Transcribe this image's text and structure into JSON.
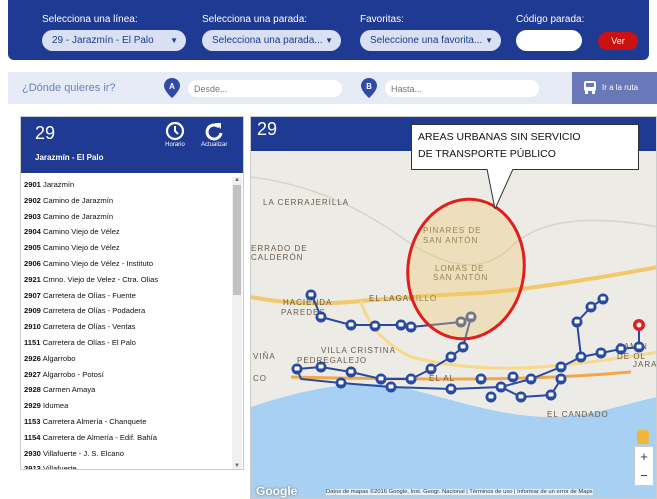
{
  "top": {
    "line_label": "Selecciona una línea:",
    "line_value": "29 - Jarazmín - El Palo",
    "stop_label": "Selecciona una parada:",
    "stop_value": "Selecciona una parada...",
    "fav_label": "Favoritas:",
    "fav_value": "Seleccione una favorita...",
    "code_label": "Código parada:",
    "ver_label": "Ver"
  },
  "route": {
    "question": "¿Dónde quieres ir?",
    "from_marker": "A",
    "from_placeholder": "Desde...",
    "to_marker": "B",
    "to_placeholder": "Hasta...",
    "go_label": "Ir a la ruta"
  },
  "line_panel": {
    "number": "29",
    "name": "Jarazmín - El Palo",
    "schedule_label": "Horario",
    "refresh_label": "Actualizar",
    "stops": [
      {
        "code": "2901",
        "name": "Jarazmín"
      },
      {
        "code": "2902",
        "name": "Camino de Jarazmín"
      },
      {
        "code": "2903",
        "name": "Camino de Jarazmín"
      },
      {
        "code": "2904",
        "name": "Camino Viejo de Vélez"
      },
      {
        "code": "2905",
        "name": "Camino Viejo de Vélez"
      },
      {
        "code": "2906",
        "name": "Camino Viejo de Vélez - Instituto"
      },
      {
        "code": "2921",
        "name": "Cmno. Viejo de Velez - Ctra. Olias"
      },
      {
        "code": "2907",
        "name": "Carretera de Olías - Fuente"
      },
      {
        "code": "2909",
        "name": "Carretera de Olías - Podadera"
      },
      {
        "code": "2910",
        "name": "Carretera de Olías - Ventas"
      },
      {
        "code": "1151",
        "name": "Carretera de Olías - El Palo"
      },
      {
        "code": "2926",
        "name": "Algarrobo"
      },
      {
        "code": "2927",
        "name": "Algarrobo - Potosí"
      },
      {
        "code": "2928",
        "name": "Carmen Amaya"
      },
      {
        "code": "2929",
        "name": "Idumea"
      },
      {
        "code": "1153",
        "name": "Carretera Almería - Chanquete"
      },
      {
        "code": "1154",
        "name": "Carretera de Almería - Edif. Bahía"
      },
      {
        "code": "2930",
        "name": "Villafuerte - J. S. Elcano"
      },
      {
        "code": "2913",
        "name": "Villafuerte"
      }
    ]
  },
  "map": {
    "number": "29",
    "callout_line1": "AREAS URBANAS SIN SERVICIO",
    "callout_line2": "DE TRANSPORTE PÚBLICO",
    "places": {
      "cerrajerilla": "LA CERRAJERILLA",
      "pinares1": "PINARES DE",
      "pinares2": "SAN ANTÓN",
      "lomas1": "LOMAS DE",
      "lomas2": "SAN ANTÓN",
      "parado1": "ERRADO DE",
      "parado2": "CALDERÓN",
      "lagarillo": "EL LAGARILLO",
      "hacienda1": "HACIENDA",
      "hacienda2": "PAREDES",
      "cristina": "VILLA CRISTINA",
      "pedregalejo": "PEDREGALEJO",
      "vina": "VIÑA",
      "candado": "EL CANDADO",
      "camino1": "CAMIN",
      "camino2": "DE OL",
      "jarazmin": "JARAZ",
      "co": "CO",
      "alcu": "EL AL"
    },
    "google": "Google",
    "attribution": "Datos de mapas ©2016 Google, Inst. Geogr. Nacional | Términos de uso | Informar de un error de Maps",
    "zoom_in": "+",
    "zoom_out": "−",
    "colors": {
      "land": "#ecebe6",
      "sea": "#a7d0f2",
      "route": "#2a4aa0",
      "highlight": "#e11d1d",
      "highway": "#f2c86a"
    }
  }
}
